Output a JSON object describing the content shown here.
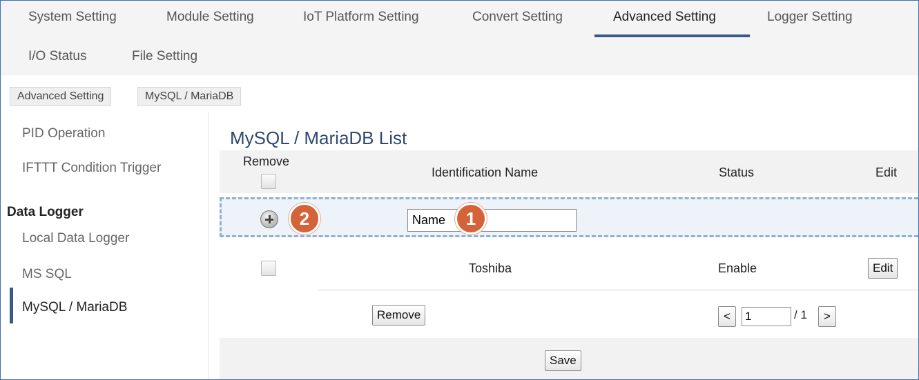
{
  "nav": {
    "tabs": [
      {
        "label": "System Setting"
      },
      {
        "label": "Module Setting"
      },
      {
        "label": "IoT Platform Setting"
      },
      {
        "label": "Convert Setting"
      },
      {
        "label": "Advanced Setting"
      },
      {
        "label": "Logger Setting"
      },
      {
        "label": "I/O Status"
      },
      {
        "label": "File Setting"
      }
    ],
    "active_tab": "Advanced Setting"
  },
  "breadcrumb": [
    "Advanced Setting",
    "MySQL / MariaDB"
  ],
  "sidebar": {
    "items_top": [
      "PID Operation",
      "IFTTT Condition Trigger"
    ],
    "section_heading": "Data Logger",
    "items_logger": [
      "Local Data Logger",
      "MS SQL",
      "MySQL / MariaDB"
    ],
    "active_item": "MySQL / MariaDB"
  },
  "main": {
    "title": "MySQL / MariaDB List",
    "columns": {
      "remove": "Remove",
      "name": "Identification Name",
      "status": "Status",
      "edit": "Edit"
    },
    "new_entry": {
      "name_value": "Name",
      "add_icon": "plus-circle-icon"
    },
    "markers": [
      "1",
      "2"
    ],
    "rows": [
      {
        "name": "Toshiba",
        "status": "Enable",
        "edit_label": "Edit",
        "checked": false
      }
    ],
    "remove_button": "Remove",
    "pager": {
      "prev": "<",
      "current": "1",
      "total": "/ 1",
      "next": ">"
    },
    "save_button": "Save"
  },
  "colors": {
    "accent": "#3a5a86",
    "title": "#2f4a6d",
    "marker": "#d4633a",
    "dashed_border": "#8fb0d6"
  }
}
